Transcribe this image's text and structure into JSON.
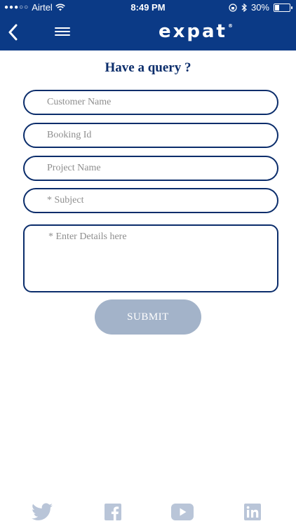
{
  "status_bar": {
    "signal": "●●●○○",
    "carrier": "Airtel",
    "time": "8:49 PM",
    "battery": "30%",
    "battery_level": 0.3
  },
  "header": {
    "logo": "expat",
    "logo_mark": "®"
  },
  "form": {
    "title": "Have a query ?",
    "customer_name_placeholder": "Customer Name",
    "booking_id_placeholder": "Booking Id",
    "project_name_placeholder": "Project Name",
    "subject_placeholder": "* Subject",
    "details_placeholder": "* Enter Details here",
    "submit_label": "SUBMIT"
  },
  "footer": {
    "icons": [
      "twitter-icon",
      "facebook-icon",
      "youtube-icon",
      "linkedin-icon"
    ]
  },
  "colors": {
    "brand": "#0b3a86",
    "border": "#0b2d6b",
    "submit": "#a3b3c9",
    "social": "#b9c5d8"
  }
}
